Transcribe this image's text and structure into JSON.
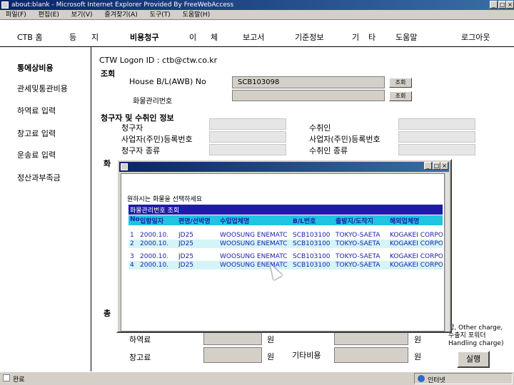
{
  "window": {
    "title": "about:blank - Microsoft Internet Explorer Provided By FreeWebAccess"
  },
  "menubar": {
    "items": [
      "파일(F)",
      "편집(E)",
      "보기(V)",
      "즐겨찾기(A)",
      "도구(T)",
      "도움말(H)"
    ]
  },
  "topnav": {
    "items": [
      "CTB 홈",
      "등",
      "지",
      "비용청구",
      "이",
      "체",
      "보고서",
      "기준정보",
      "기",
      "타",
      "도움말",
      "로그아웃"
    ]
  },
  "sidebar": {
    "items": [
      "통에상비용",
      "관세및통관비용",
      "하역료 입력",
      "창고료 입력",
      "운송료 입력",
      "정산과부족금"
    ]
  },
  "main": {
    "logon": "CTW Logon ID : ctb@ctw.co.kr",
    "lookup_section": "조회",
    "house_bl_label": "House B/L(AWB) No",
    "house_bl_value": "SCB103098",
    "lookup_button": "조회",
    "cargo_label": "화물관리번호",
    "claim_section": "청구자 및 수취인 정보",
    "claimant_label": "청구자",
    "claimant_reg_label": "사업자(주민)등록번호",
    "claimant_type_label": "청구자 종류",
    "recipient_label": "수취인",
    "recipient_reg_label": "사업자(주민)등록번호",
    "recipient_type_label": "수취인 종류",
    "partial_section": "화",
    "partial_total": "총",
    "loading_label": "하역료",
    "storage_label": "창고료",
    "other_label": "기타비용",
    "won": "원",
    "note": "함, Other charge, 수출지 포워더 Handling charge)",
    "run_button": "실행"
  },
  "popup": {
    "instruction": "원하시는 화물을 선택하세요",
    "list_title": "화물관리번호 조회",
    "columns": [
      "No",
      "입항일자",
      "편명/선박명",
      "수입업체명",
      "B/L번호",
      "출발지/도착지",
      "해외업체명"
    ],
    "rows": [
      [
        "1",
        "2000.10.",
        "JD25",
        "WOOSUNG ENEMATC",
        "SCB103100",
        "TOKYO-SAETA",
        "KOGAKEI CORPORATION"
      ],
      [
        "2",
        "2000.10.",
        "JD25",
        "WOOSUNG ENEMATC",
        "SCB103100",
        "TOKYO-SAETA",
        "KOGAKEI CORPORATION"
      ],
      [
        "3",
        "2000.10.",
        "JD25",
        "WOOSUNG ENEMATC",
        "SCB103100",
        "TOKYO-SAETA",
        "KOGAKEI CORPORATION"
      ],
      [
        "4",
        "2000.10.",
        "JD25",
        "WOOSUNG ENEMATC",
        "SCB103100",
        "TOKYO-SAETA",
        "KOGAKEI CORPORATION"
      ]
    ]
  },
  "statusbar": {
    "left": "완료",
    "right": "인터넷"
  },
  "colors": {
    "titlebar": "#0a246a",
    "grid_header": "#1c1ca8",
    "row_a": "#ffffff",
    "row_b": "#d4f4f8",
    "grid_text": "#1c1ca8"
  }
}
